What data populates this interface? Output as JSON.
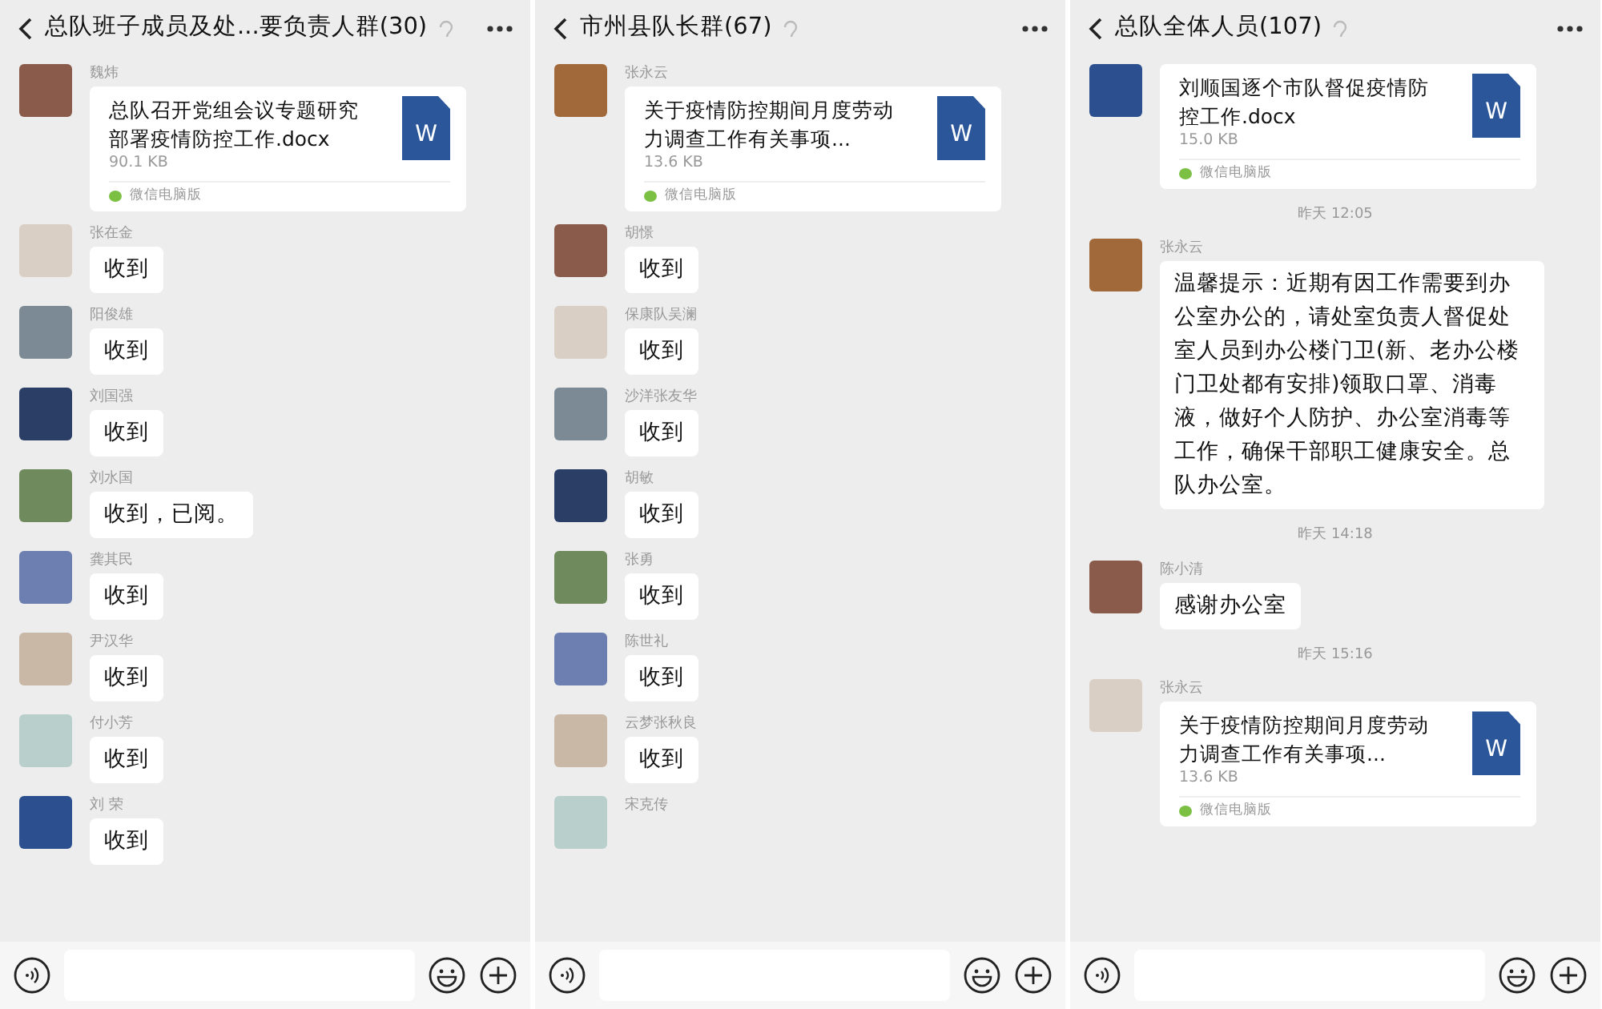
{
  "panels": [
    {
      "title": "总队班子成员及处...要负责人群(30)",
      "messages": [
        {
          "kind": "file",
          "sender": "魏炜",
          "file_name": "总队召开党组会议专题研究部署疫情防控工作.docx",
          "file_size": "90.1 KB",
          "icon_label": "W",
          "source": "微信电脑版"
        },
        {
          "kind": "text",
          "sender": "张在金",
          "text": "收到"
        },
        {
          "kind": "text",
          "sender": "阳俊雄",
          "text": "收到"
        },
        {
          "kind": "text",
          "sender": "刘国强",
          "text": "收到"
        },
        {
          "kind": "text",
          "sender": "刘水国",
          "text": "收到，已阅。"
        },
        {
          "kind": "text",
          "sender": "龚其民",
          "text": "收到"
        },
        {
          "kind": "text",
          "sender": "尹汉华",
          "text": "收到"
        },
        {
          "kind": "text",
          "sender": "付小芳",
          "text": "收到"
        },
        {
          "kind": "text",
          "sender": "刘 荣",
          "text": "收到"
        }
      ]
    },
    {
      "title": "市州县队长群(67)",
      "messages": [
        {
          "kind": "file",
          "sender": "张永云",
          "file_name": "关于疫情防控期间月度劳动力调查工作有关事项...",
          "file_size": "13.6 KB",
          "icon_label": "W",
          "source": "微信电脑版"
        },
        {
          "kind": "text",
          "sender": "胡憬",
          "text": "收到"
        },
        {
          "kind": "text",
          "sender": "保康队吴澜",
          "text": "收到"
        },
        {
          "kind": "text",
          "sender": "沙洋张友华",
          "text": "收到"
        },
        {
          "kind": "text",
          "sender": "胡敏",
          "text": "收到"
        },
        {
          "kind": "text",
          "sender": "张勇",
          "text": "收到"
        },
        {
          "kind": "text",
          "sender": "陈世礼",
          "text": "收到"
        },
        {
          "kind": "text",
          "sender": "云梦张秋良",
          "text": "收到"
        },
        {
          "kind": "sender_only",
          "sender": "宋克传"
        }
      ]
    },
    {
      "title": "总队全体人员(107)",
      "messages": [
        {
          "kind": "file",
          "file_name": "刘顺国逐个市队督促疫情防控工作.docx",
          "file_size": "15.0 KB",
          "icon_label": "W",
          "source": "微信电脑版"
        },
        {
          "kind": "time",
          "text": "昨天 12:05"
        },
        {
          "kind": "text",
          "sender": "张永云",
          "text": "温馨提示：近期有因工作需要到办公室办公的，请处室负责人督促处室人员到办公楼门卫(新、老办公楼门卫处都有安排)领取口罩、消毒液，做好个人防护、办公室消毒等工作，确保干部职工健康安全。总队办公室。"
        },
        {
          "kind": "time",
          "text": "昨天 14:18"
        },
        {
          "kind": "text",
          "sender": "陈小清",
          "text": "感谢办公室"
        },
        {
          "kind": "time",
          "text": "昨天 15:16"
        },
        {
          "kind": "file",
          "sender": "张永云",
          "file_name": "关于疫情防控期间月度劳动力调查工作有关事项...",
          "file_size": "13.6 KB",
          "icon_label": "W",
          "source": "微信电脑版"
        }
      ]
    }
  ]
}
